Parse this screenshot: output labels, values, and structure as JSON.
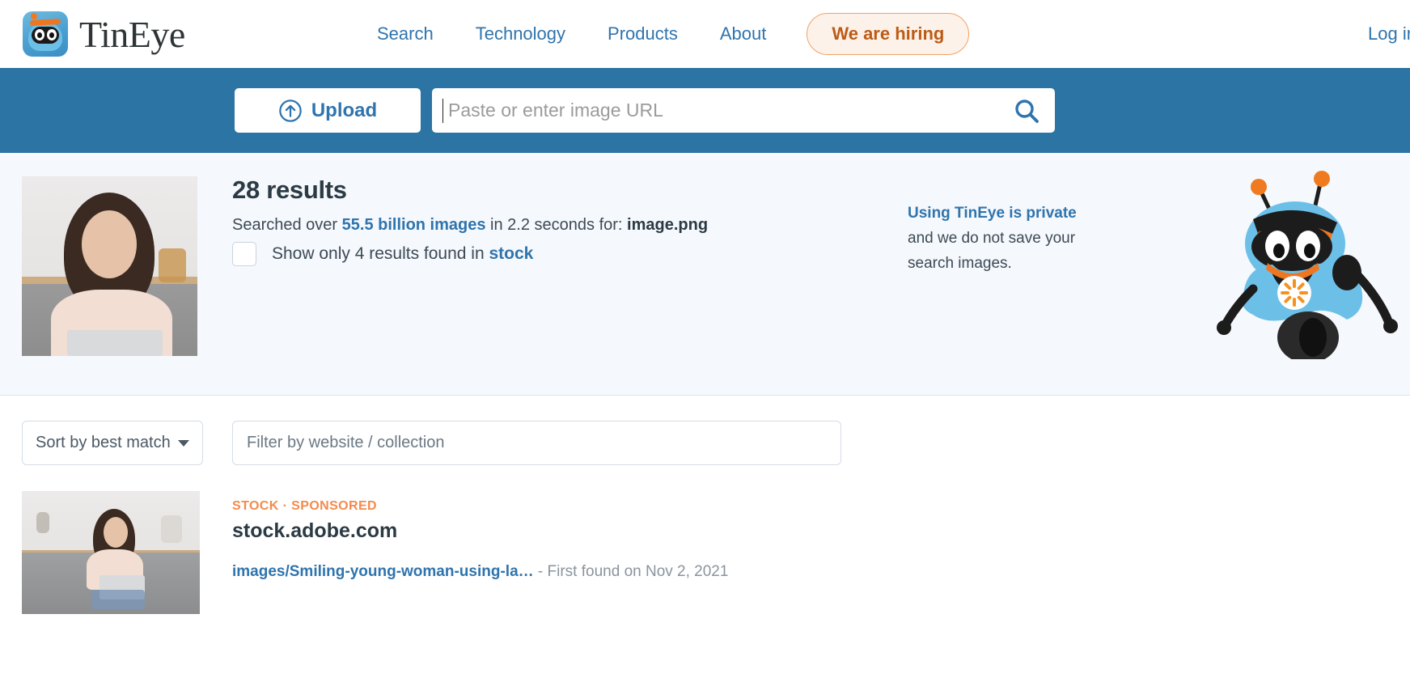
{
  "header": {
    "brand": "TinEye",
    "logo_icon": "tineye-robot-logo",
    "nav": [
      {
        "label": "Search"
      },
      {
        "label": "Technology"
      },
      {
        "label": "Products"
      },
      {
        "label": "About"
      }
    ],
    "hiring_label": "We are hiring",
    "login_label": "Log in"
  },
  "search": {
    "upload_label": "Upload",
    "upload_icon": "arrow-up-circle-icon",
    "url_value": "",
    "url_placeholder": "Paste or enter image URL",
    "search_icon": "search-icon"
  },
  "summary": {
    "results_count": "28 results",
    "searched_prefix": "Searched over ",
    "image_count": "55.5 billion images",
    "searched_middle": " in 2.2 seconds for: ",
    "filename": "image.png",
    "stock_checkbox_checked": false,
    "stock_prefix": "Show only 4 results found in ",
    "stock_link": "stock",
    "privacy_title": "Using TinEye is private",
    "privacy_body": "and we do not save your search images.",
    "query_thumb_alt": "query-image-woman-with-laptop",
    "robot_icon": "tineye-robot-mascot"
  },
  "controls": {
    "sort_label": "Sort by best match",
    "sort_icon": "chevron-down-icon",
    "filter_value": "",
    "filter_placeholder": "Filter by website / collection"
  },
  "results": [
    {
      "badge_stock": "STOCK",
      "badge_separator": "·",
      "badge_sponsored": "SPONSORED",
      "domain": "stock.adobe.com",
      "path": "images/Smiling-young-woman-using-la…",
      "first_found": " - First found on Nov 2, 2021",
      "thumb_alt": "result-image-woman-on-couch-with-laptop"
    }
  ],
  "colors": {
    "band_blue": "#2b74a3",
    "link_blue": "#2f74ad",
    "accent_orange": "#ef7620",
    "summary_bg": "#f5f8fc",
    "badge_orange": "#f58a4b"
  }
}
